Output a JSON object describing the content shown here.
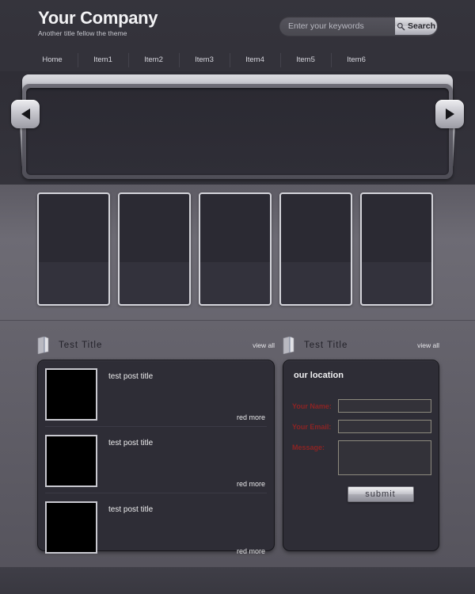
{
  "header": {
    "brand_title": "Your Company",
    "brand_subtitle": "Another  title fellow the theme",
    "search": {
      "placeholder": "Enter your keywords",
      "value": "",
      "button_label": "Search",
      "icon": "magnifier-icon"
    }
  },
  "nav": {
    "items": [
      {
        "label": "Home"
      },
      {
        "label": "Item1"
      },
      {
        "label": "Item2"
      },
      {
        "label": "Item3"
      },
      {
        "label": "Item4"
      },
      {
        "label": "Item5"
      },
      {
        "label": "Item6"
      }
    ]
  },
  "slider": {
    "prev_icon": "arrow-left-icon",
    "next_icon": "arrow-right-icon",
    "slides": [
      {
        "label": ""
      }
    ]
  },
  "thumbnails": {
    "items": [
      {
        "label": ""
      },
      {
        "label": ""
      },
      {
        "label": ""
      },
      {
        "label": ""
      },
      {
        "label": ""
      }
    ]
  },
  "sections": {
    "left": {
      "icon": "book-icon",
      "title": "Test   Title",
      "view_all_label": "view all",
      "posts": [
        {
          "title": "test post title",
          "read_more_label": "red more"
        },
        {
          "title": "test post title",
          "read_more_label": "red more"
        },
        {
          "title": "test post title",
          "read_more_label": "red more"
        }
      ]
    },
    "right": {
      "icon": "book-icon",
      "title": "Test   Title",
      "view_all_label": "view all",
      "panel_title": "our location",
      "form": {
        "name_label": "Your Name:",
        "name_value": "",
        "email_label": "Your Email:",
        "email_value": "",
        "message_label": "Message:",
        "message_value": "",
        "submit_label": "submit"
      }
    }
  },
  "colors": {
    "page_dark": "#33323a",
    "mid_grey": "#66646d",
    "panel_dark": "#2e2d36",
    "metal_light": "#ededf0",
    "form_label_red": "#8c2424",
    "text_light": "#f2f2f4"
  }
}
